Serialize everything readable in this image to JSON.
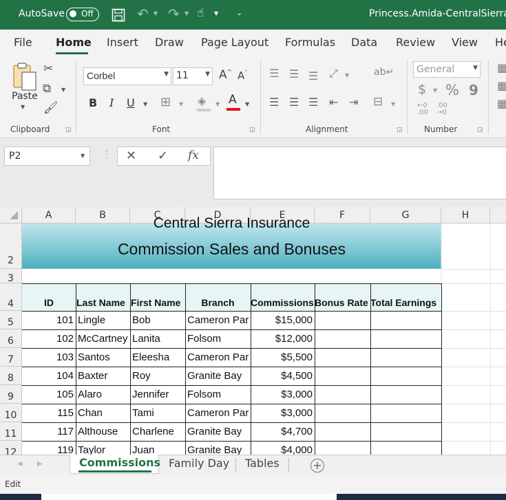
{
  "titlebar": {
    "autosave_label": "AutoSave",
    "autosave_state": "Off",
    "doc_title": "Princess.Amida-CentralSierra-C"
  },
  "ribbon_tabs": [
    "File",
    "Home",
    "Insert",
    "Draw",
    "Page Layout",
    "Formulas",
    "Data",
    "Review",
    "View",
    "He"
  ],
  "clipboard": {
    "paste_label": "Paste",
    "group_label": "Clipboard"
  },
  "font": {
    "family": "Corbel",
    "size": "11",
    "group_label": "Font",
    "bold": "B",
    "italic": "I",
    "underline": "U",
    "font_color": "#e81123"
  },
  "alignment": {
    "group_label": "Alignment"
  },
  "number": {
    "format": "General",
    "group_label": "Number",
    "currency": "$",
    "percent": "%",
    "comma": "9"
  },
  "formula_bar": {
    "name_box": "P2",
    "fx": "fx",
    "value": ""
  },
  "columns": [
    "A",
    "B",
    "C",
    "D",
    "E",
    "F",
    "G",
    "H"
  ],
  "rows": [
    "2",
    "3",
    "4",
    "5",
    "6",
    "7",
    "8",
    "9",
    "10",
    "11",
    "12"
  ],
  "sheet": {
    "title_line1": "Central Sierra Insurance",
    "title_line2": "Commission Sales and Bonuses",
    "headers": [
      "ID",
      "Last Name",
      "First Name",
      "Branch",
      "Commissions",
      "Bonus Rate",
      "Total Earnings"
    ],
    "records": [
      [
        "101",
        "Lingle",
        "Bob",
        "Cameron Par",
        "$15,000"
      ],
      [
        "102",
        "McCartney",
        "Lanita",
        "Folsom",
        "$12,000"
      ],
      [
        "103",
        "Santos",
        "Eleesha",
        "Cameron Par",
        "$5,500"
      ],
      [
        "104",
        "Baxter",
        "Roy",
        "Granite Bay",
        "$4,500"
      ],
      [
        "105",
        "Alaro",
        "Jennifer",
        "Folsom",
        "$3,000"
      ],
      [
        "115",
        "Chan",
        "Tami",
        "Cameron Par",
        "$3,000"
      ],
      [
        "117",
        "Althouse",
        "Charlene",
        "Granite Bay",
        "$4,700"
      ],
      [
        "119",
        "Taylor",
        "Juan",
        "Granite Bay",
        "$4,000"
      ]
    ]
  },
  "sheet_tabs": [
    "Commissions",
    "Family Day",
    "Tables"
  ],
  "status": {
    "mode": "Edit"
  },
  "colors": {
    "excel_green": "#217346",
    "title_fill_top": "#bfe6ec",
    "title_fill_bottom": "#4fb0c1"
  }
}
